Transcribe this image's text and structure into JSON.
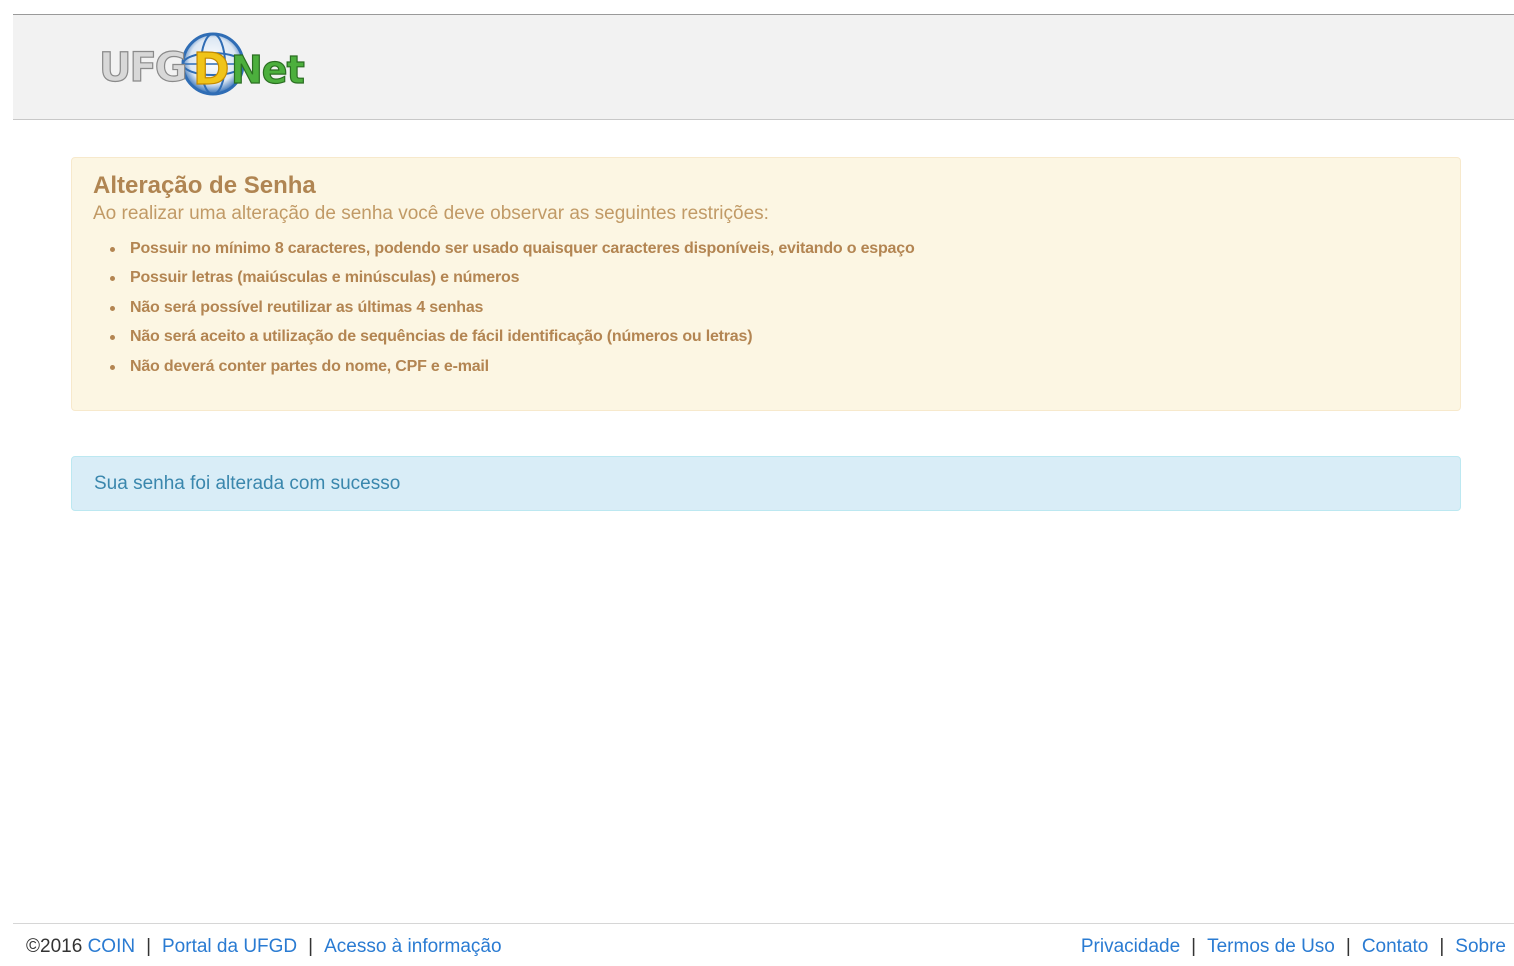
{
  "header": {
    "logo_text": "UFGDNet",
    "logo_colors": {
      "letters_grey": "#c9c9c9",
      "d_yellow": "#f0c419",
      "net_green": "#4caf3d",
      "globe_blue": "#2f6db5"
    }
  },
  "warning": {
    "title": "Alteração de Senha",
    "subtitle": "Ao realizar uma alteração de senha você deve observar as seguintes restrições:",
    "rules": [
      "Possuir no mínimo 8 caracteres, podendo ser usado quaisquer caracteres disponíveis, evitando o espaço",
      "Possuir letras (maiúsculas e minúsculas) e números",
      "Não será possível reutilizar as últimas 4 senhas",
      "Não será aceito a utilização de sequências de fácil identificação (números ou letras)",
      "Não deverá conter partes do nome, CPF e e-mail"
    ]
  },
  "info": {
    "message": "Sua senha foi alterada com sucesso"
  },
  "footer": {
    "copyright": "©2016",
    "left_links": [
      "COIN",
      "Portal da UFGD",
      "Acesso à informação"
    ],
    "right_links": [
      "Privacidade",
      "Termos de Uso",
      "Contato",
      "Sobre"
    ],
    "separator": "|"
  }
}
